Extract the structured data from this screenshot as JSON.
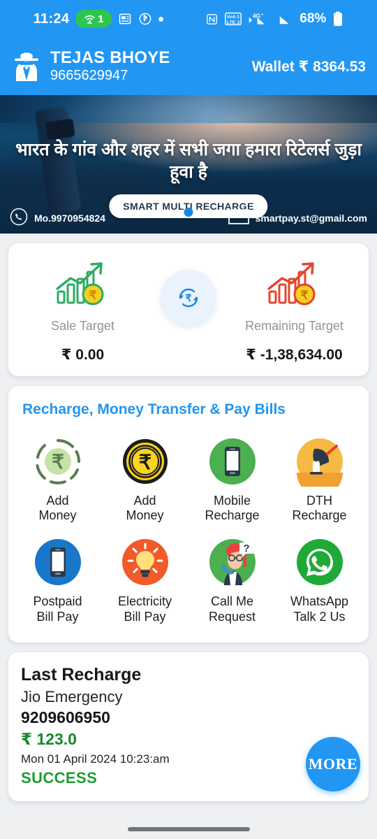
{
  "status_bar": {
    "time": "11:24",
    "hotspot_badge": "1",
    "battery_percent": "68%",
    "icons": [
      "hotspot-icon",
      "news-icon",
      "bluetooth-b-icon",
      "dot-icon",
      "nfc-icon",
      "volte-dual-sim-icon",
      "signal-4g-plus-icon",
      "signal-bars-icon",
      "battery-icon"
    ],
    "network_label": "4G",
    "volte_label_top": "VoA 1",
    "volte_label_bottom": "LTE 2"
  },
  "header": {
    "avatar_icon": "spy-agent-avatar-icon",
    "user_name": "TEJAS BHOYE",
    "user_mobile": "9665629947",
    "wallet_label": "Wallet",
    "wallet_currency": "₹",
    "wallet_amount": "8364.53",
    "background_color": "#2196F3"
  },
  "banner": {
    "headline": "भारत के गांव और शहर में सभी जगा हमारा रिटेलर्स जुड़ा हूवा है",
    "brand_pill": "SMART MULTI RECHARGE",
    "contact_phone": "Mo.9970954824",
    "contact_email": "smartpay.st@gmail.com",
    "phone_icon": "phone-call-icon",
    "email_icon": "envelope-icon"
  },
  "target_card": {
    "sale": {
      "icon": "green-growth-chart-icon",
      "label": "Sale Target",
      "value": "₹ 0.00",
      "color": "#2eab63"
    },
    "refresh": {
      "icon": "refresh-rupee-icon",
      "color": "#2196F3"
    },
    "remaining": {
      "icon": "red-growth-chart-icon",
      "label": "Remaining Target",
      "value": "₹ -1,38,634.00",
      "color": "#e4442e"
    }
  },
  "services": {
    "title": "Recharge, Money Transfer & Pay Bills",
    "title_color": "#2196F3",
    "items": [
      {
        "icon": "add-money-wallet-icon",
        "line1": "Add",
        "line2": "Money",
        "color": "#5a7d4e"
      },
      {
        "icon": "gold-coin-rupee-icon",
        "line1": "Add",
        "line2": "Money",
        "color": "#f5d020"
      },
      {
        "icon": "mobile-recharge-icon",
        "line1": "Mobile",
        "line2": "Recharge",
        "color": "#4caf50"
      },
      {
        "icon": "dth-satellite-dish-icon",
        "line1": "DTH",
        "line2": "Recharge",
        "color": "#f7b944"
      },
      {
        "icon": "postpaid-phone-icon",
        "line1": "Postpaid",
        "line2": "Bill Pay",
        "color": "#1877c9"
      },
      {
        "icon": "electricity-bulb-icon",
        "line1": "Electricity",
        "line2": "Bill Pay",
        "color": "#f15a29"
      },
      {
        "icon": "call-me-request-icon",
        "line1": "Call Me",
        "line2": "Request",
        "color": "#4caf50"
      },
      {
        "icon": "whatsapp-icon",
        "line1": "WhatsApp",
        "line2": "Talk 2 Us",
        "color": "#1faa38"
      }
    ]
  },
  "last_recharge": {
    "title": "Last Recharge",
    "operator": "Jio Emergency",
    "number": "9209606950",
    "amount": "₹ 123.0",
    "datetime": "Mon 01 April 2024 10:23:am",
    "status": "SUCCESS",
    "status_color": "#1a9e32",
    "more_button": "MORE",
    "more_button_color": "#2196F3"
  },
  "nav_bar": {
    "handle": "gesture-nav-handle"
  }
}
